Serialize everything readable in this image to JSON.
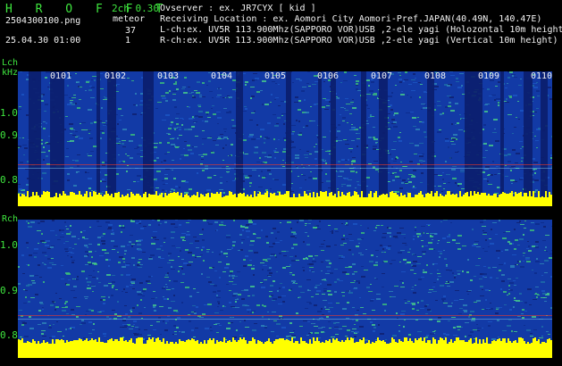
{
  "header": {
    "brand": "H R O F F T",
    "version": "2ch 0.30",
    "filename": "2504300100.png",
    "mode": "meteor",
    "datetime": "25.04.30 01:00",
    "count_l": "37",
    "count_r": "1",
    "observer": "Ovserver            : ex. JR7CYX [ kid ]",
    "location": "Receiving Location : ex. Aomori City Aomori-Pref.JAPAN(40.49N, 140.47E)",
    "lch": "L-ch:ex. UV5R 113.900Mhz(SAPPORO VOR)USB ,2-ele yagi (Holozontal 10m height)",
    "rch": "R-ch:ex. UV5R 113.900Mhz(SAPPORO VOR)USB ,2-ele yagi (Vertical 10m height)"
  },
  "left_panel": {
    "label": "Lch",
    "unit": "kHz",
    "y_ticks": [
      "1.0",
      "0.9",
      "0.8"
    ],
    "time_ticks": [
      "0101",
      "0102",
      "0103",
      "0104",
      "0105",
      "0106",
      "0107",
      "0108",
      "0109",
      "0110"
    ]
  },
  "right_panel": {
    "label": "Rch",
    "y_ticks": [
      "1.0",
      "0.9",
      "0.8"
    ]
  },
  "colors": {
    "label_green": "#3fe63f",
    "tick_cyan": "#5fe8ff",
    "noise_blue": "#123aa6",
    "noise_green": "#3cc07a",
    "floor_yellow": "#ffff00",
    "meteor_red": "#ff3b20"
  }
}
